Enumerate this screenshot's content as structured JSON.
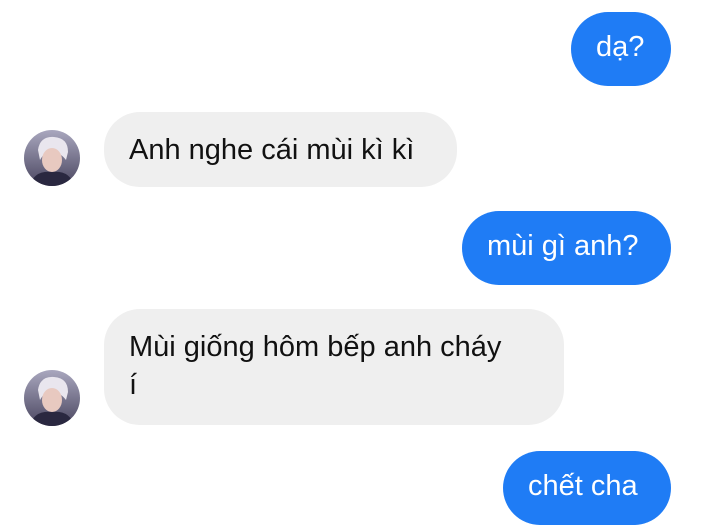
{
  "messages": [
    {
      "direction": "outgoing",
      "text": "dạ?"
    },
    {
      "direction": "incoming",
      "text": "Anh nghe cái mùi kì kì",
      "avatar_icon": "contact-avatar-icon"
    },
    {
      "direction": "outgoing",
      "text": "mùi gì anh?"
    },
    {
      "direction": "incoming",
      "lines": [
        "Mùi giống hôm bếp anh cháy",
        "í"
      ],
      "avatar_icon": "contact-avatar-icon"
    },
    {
      "direction": "outgoing",
      "text": "chết cha"
    }
  ],
  "colors": {
    "outgoing_bubble": "#1f7cf5",
    "incoming_bubble": "#efefef",
    "background": "#ffffff"
  }
}
